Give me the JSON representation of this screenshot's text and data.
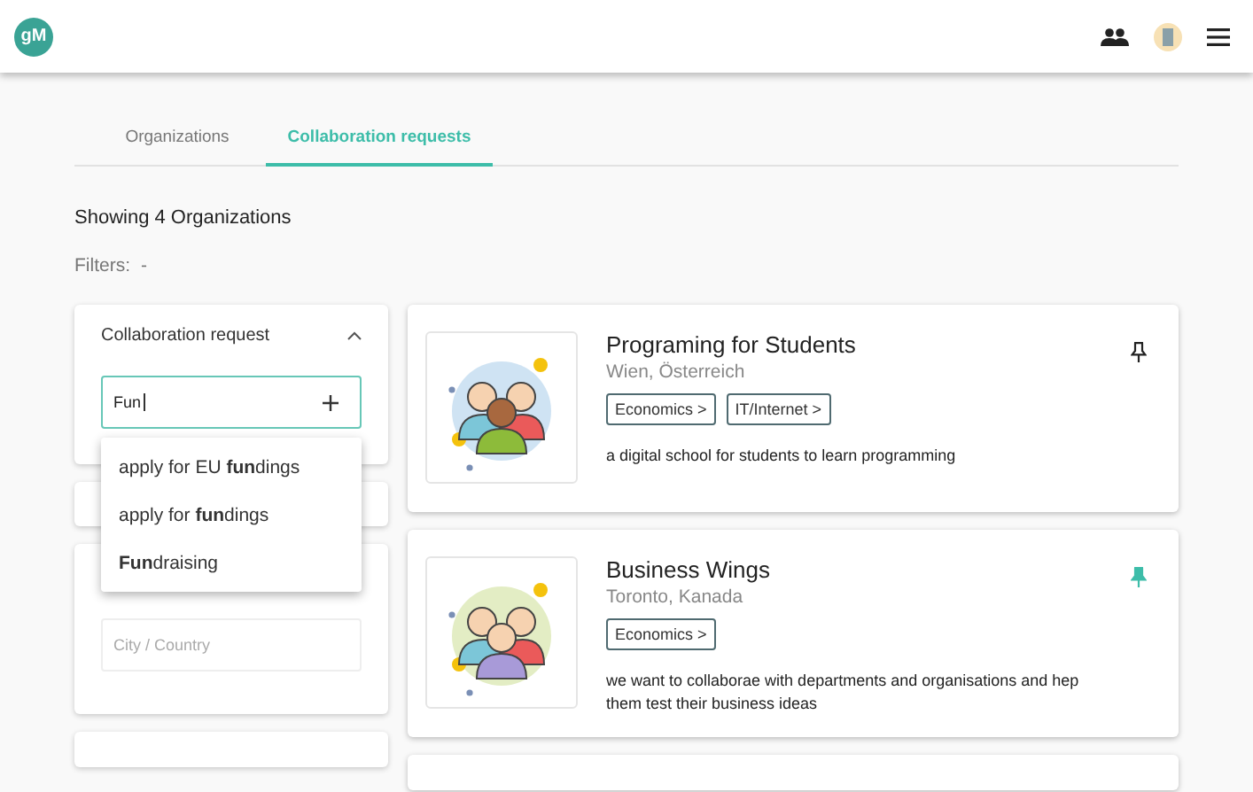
{
  "header": {
    "logo": "gM"
  },
  "tabs": [
    {
      "label": "Organizations",
      "selected": false
    },
    {
      "label": "Collaboration requests",
      "selected": true
    }
  ],
  "summary": "Showing 4 Organizations",
  "filters": {
    "label": "Filters:",
    "value": "-"
  },
  "request_filter": {
    "title": "Collaboration request",
    "expanded": true,
    "value": "Fun",
    "suggestions": [
      "apply for EU **fun**dings",
      "apply for **fun**dings",
      "**Fun**draising"
    ]
  },
  "location_filter": {
    "placeholder": "City / Country"
  },
  "organizations": [
    {
      "name": "Programing for Students",
      "location": "Wien, Österreich",
      "tags": [
        "Economics >",
        "IT/Internet >"
      ],
      "description": "a digital school for students to learn programming",
      "pinned": false
    },
    {
      "name": "Business Wings",
      "location": "Toronto, Kanada",
      "tags": [
        "Economics >"
      ],
      "description": "we want to collaborae with departments and organisations and hep them test their business ideas",
      "pinned": true
    }
  ]
}
